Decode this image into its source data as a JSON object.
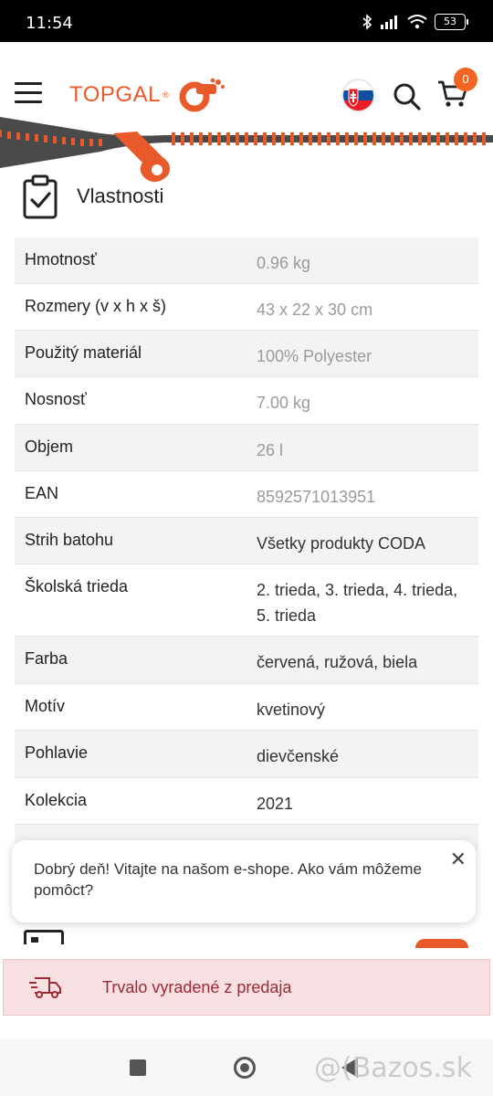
{
  "status": {
    "time": "11:54",
    "battery": "53"
  },
  "header": {
    "logo_text": "TOPGAL",
    "logo_reg": "®",
    "cart_count": "0",
    "accent_color": "#e85a2a"
  },
  "section": {
    "title": "Vlastnosti"
  },
  "properties": [
    {
      "key": "Hmotnosť",
      "value": "0.96 kg"
    },
    {
      "key": "Rozmery (v x h x š)",
      "value": "43 x 22 x 30 cm"
    },
    {
      "key": "Použitý materiál",
      "value": "100% Polyester"
    },
    {
      "key": "Nosnosť",
      "value": "7.00 kg"
    },
    {
      "key": "Objem",
      "value": "26 l"
    },
    {
      "key": "EAN",
      "value": "8592571013951"
    },
    {
      "key": "Strih batohu",
      "value": "Všetky produkty CODA"
    },
    {
      "key": "Školská trieda",
      "value": "2. trieda, 3. trieda, 4. trieda, 5. trieda"
    },
    {
      "key": "Farba",
      "value": "červená, ružová, biela"
    },
    {
      "key": "Motív",
      "value": "kvetinový"
    },
    {
      "key": "Pohlavie",
      "value": "dievčenské"
    },
    {
      "key": "Kolekcia",
      "value": "2021"
    }
  ],
  "chat": {
    "message": "Dobrý deň! Vitajte na našom e-shope. Ako vám môžeme pomôct?",
    "close": "✕"
  },
  "alert": {
    "text": "Trvalo vyradené z predaja"
  },
  "watermark": "@(Bazos.sk"
}
